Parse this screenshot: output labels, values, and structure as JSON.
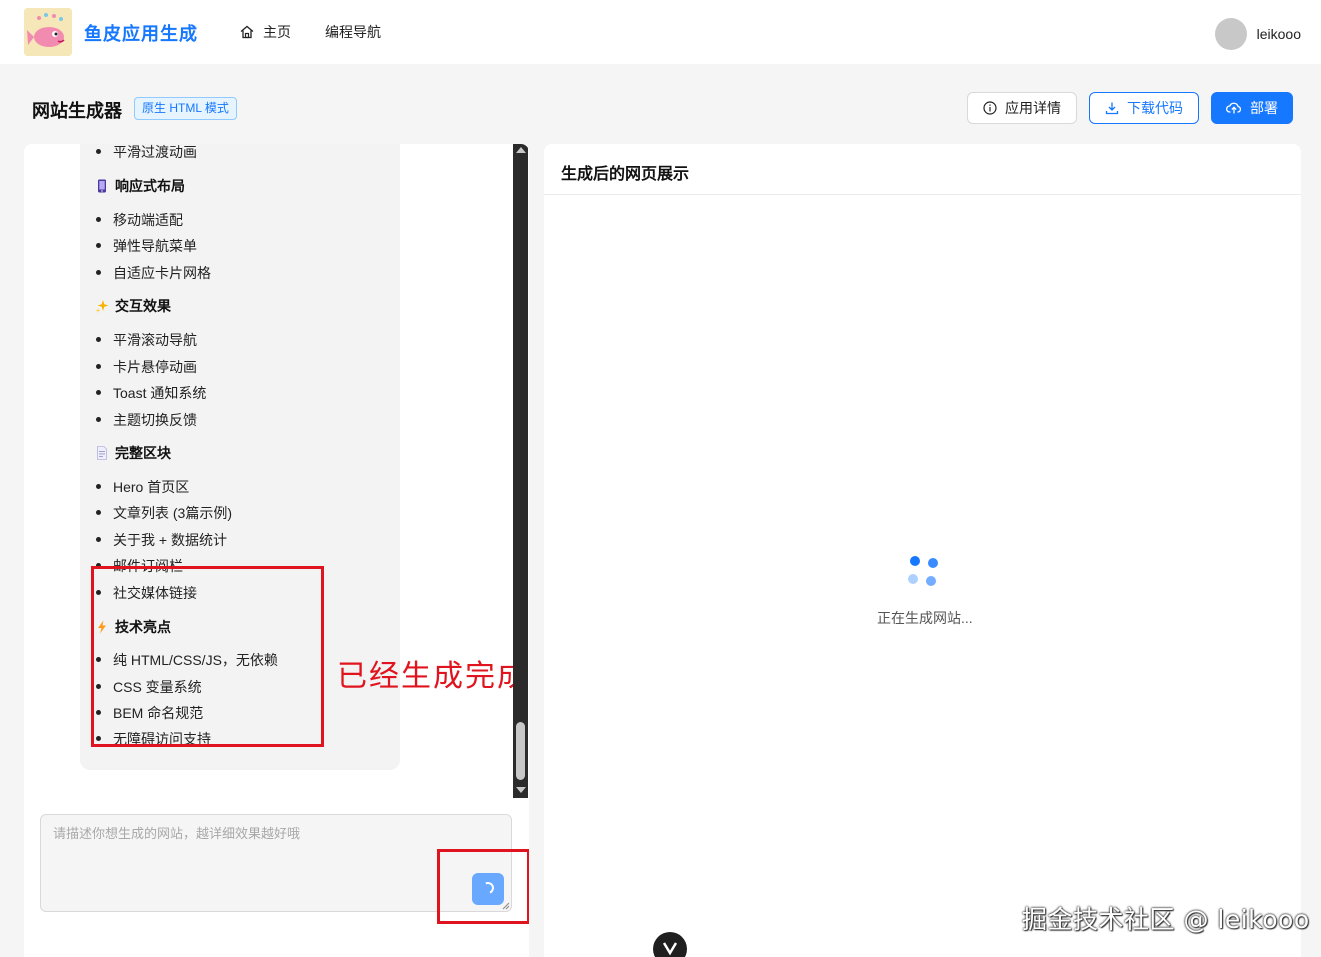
{
  "header": {
    "brand": "鱼皮应用生成",
    "nav": [
      {
        "label": "主页",
        "icon": "home-icon"
      },
      {
        "label": "编程导航"
      }
    ],
    "user": {
      "name": "leikooo"
    }
  },
  "toolbar": {
    "title": "网站生成器",
    "mode_tag": "原生 HTML 模式",
    "details_label": "应用详情",
    "download_label": "下载代码",
    "deploy_label": "部署"
  },
  "chat": {
    "items": [
      {
        "kind": "li",
        "text": "平滑过渡动画"
      },
      {
        "kind": "sec",
        "text": "响应式布局",
        "icon": "mobile-icon"
      },
      {
        "kind": "li",
        "text": "移动端适配"
      },
      {
        "kind": "li",
        "text": "弹性导航菜单"
      },
      {
        "kind": "li",
        "text": "自适应卡片网格"
      },
      {
        "kind": "sec",
        "text": "交互效果",
        "icon": "sparkle-icon"
      },
      {
        "kind": "li",
        "text": "平滑滚动导航"
      },
      {
        "kind": "li",
        "text": "卡片悬停动画"
      },
      {
        "kind": "li",
        "text": "Toast 通知系统"
      },
      {
        "kind": "li",
        "text": "主题切换反馈"
      },
      {
        "kind": "sec",
        "text": "完整区块",
        "icon": "document-icon"
      },
      {
        "kind": "li",
        "text": "Hero 首页区"
      },
      {
        "kind": "li",
        "text": "文章列表 (3篇示例)"
      },
      {
        "kind": "li",
        "text": "关于我 + 数据统计"
      },
      {
        "kind": "li",
        "text": "邮件订阅栏"
      },
      {
        "kind": "li",
        "text": "社交媒体链接"
      },
      {
        "kind": "sec",
        "text": "技术亮点",
        "icon": "lightning-icon"
      },
      {
        "kind": "li",
        "text": "纯 HTML/CSS/JS，无依赖"
      },
      {
        "kind": "li",
        "text": "CSS 变量系统"
      },
      {
        "kind": "li",
        "text": "BEM 命名规范"
      },
      {
        "kind": "li",
        "text": "无障碍访问支持"
      }
    ],
    "annotation": "已经生成完成",
    "prompt_placeholder": "请描述你想生成的网站，越详细效果越好哦"
  },
  "preview": {
    "title": "生成后的网页展示",
    "loading_text": "正在生成网站..."
  },
  "watermark": "掘金技术社区 @ leikooo",
  "colors": {
    "accent": "#1677ff",
    "annotation": "#e0141e"
  }
}
